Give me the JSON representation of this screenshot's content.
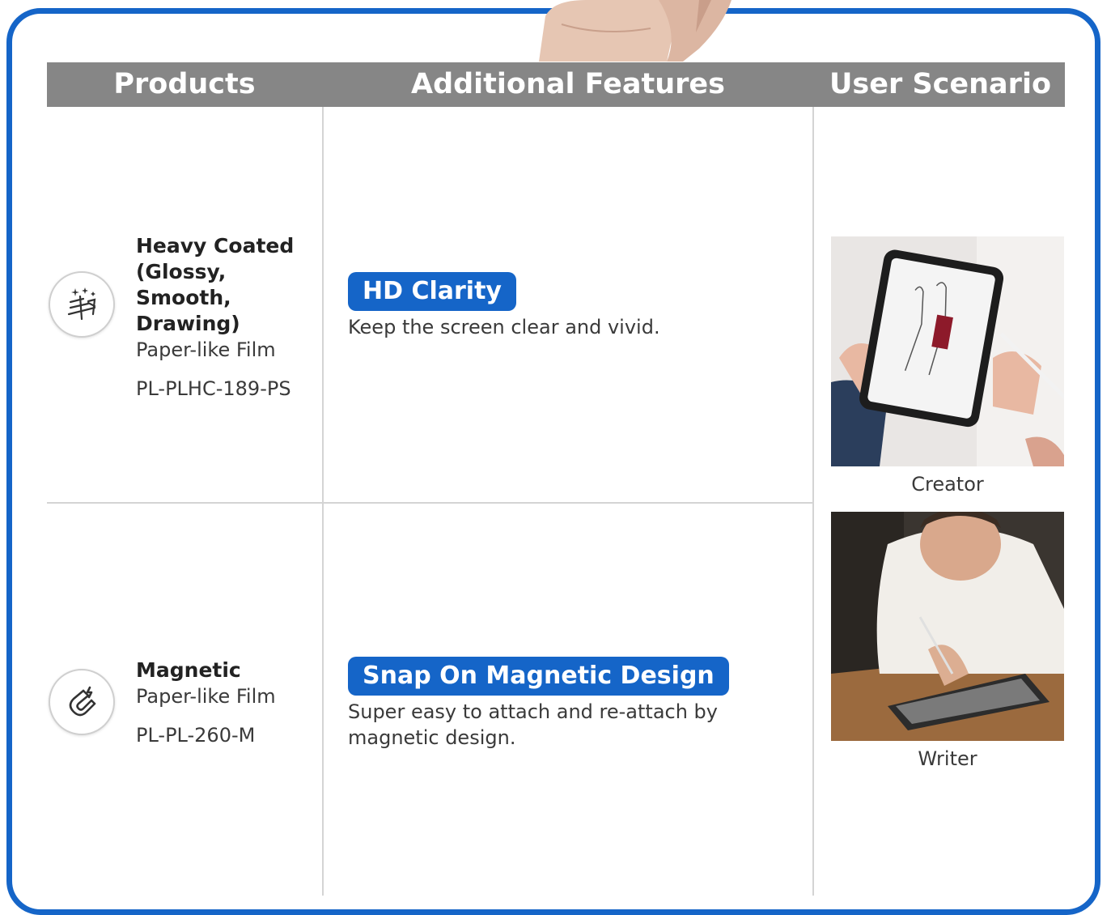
{
  "header": {
    "products": "Products",
    "features": "Additional Features",
    "scenario": "User Scenario"
  },
  "rows": [
    {
      "icon": "sparkle-pen-icon",
      "name": "Heavy Coated (Glossy, Smooth, Drawing)",
      "type": "Paper-like Film",
      "code": "PL-PLHC-189-PS",
      "feature": "HD Clarity",
      "description": "Keep the screen clear and vivid."
    },
    {
      "icon": "magnet-icon",
      "name": "Magnetic",
      "type": "Paper-like Film",
      "code": "PL-PL-260-M",
      "feature": "Snap On Magnetic Design",
      "description": "Super easy to attach and re-attach by magnetic design."
    }
  ],
  "scenarios": [
    {
      "caption": "Creator"
    },
    {
      "caption": "Writer"
    }
  ],
  "colors": {
    "accent": "#1565c8",
    "header": "#868686"
  }
}
